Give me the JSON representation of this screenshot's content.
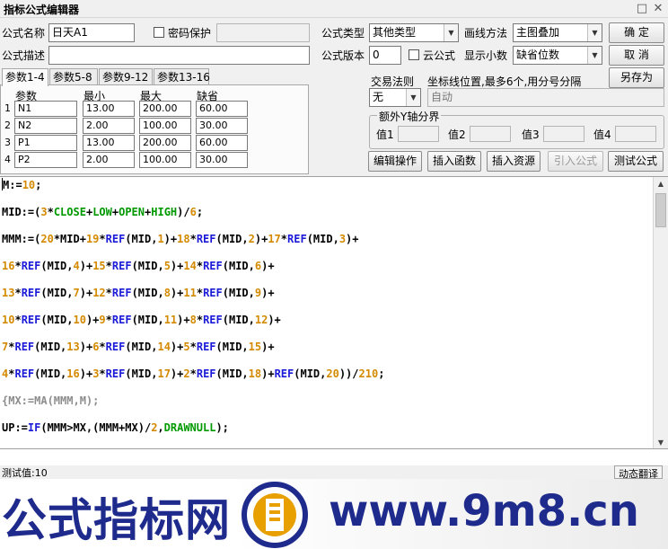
{
  "window": {
    "title": "指标公式编辑器"
  },
  "form": {
    "name_label": "公式名称",
    "name_value": "日天A1",
    "password_label": "密码保护",
    "type_label": "公式类型",
    "type_value": "其他类型",
    "draw_label": "画线方法",
    "draw_value": "主图叠加",
    "desc_label": "公式描述",
    "desc_value": "",
    "version_label": "公式版本",
    "version_value": "0",
    "cloud_label": "云公式",
    "decimal_label": "显示小数",
    "decimal_value": "缺省位数",
    "trade_label": "交易法则",
    "trade_value": "无",
    "coord_label": "坐标线位置,最多6个,用分号分隔",
    "coord_value": "自动",
    "axis_group_label": "额外Y轴分界",
    "axis_values": [
      {
        "label": "值1"
      },
      {
        "label": "值2"
      },
      {
        "label": "值3"
      },
      {
        "label": "值4"
      }
    ]
  },
  "buttons": {
    "ok": "确  定",
    "cancel": "取  消",
    "save_as": "另存为",
    "edit": "编辑操作",
    "insert_func": "插入函数",
    "insert_res": "插入资源",
    "import": "引入公式",
    "test": "测试公式"
  },
  "tabs": [
    {
      "label": "参数1-4"
    },
    {
      "label": "参数5-8"
    },
    {
      "label": "参数9-12"
    },
    {
      "label": "参数13-16"
    }
  ],
  "params": {
    "headers": [
      "参数",
      "最小",
      "最大",
      "缺省"
    ],
    "rows": [
      {
        "n": "1",
        "name": "N1",
        "min": "13.00",
        "max": "200.00",
        "def": "60.00"
      },
      {
        "n": "2",
        "name": "N2",
        "min": "2.00",
        "max": "100.00",
        "def": "30.00"
      },
      {
        "n": "3",
        "name": "P1",
        "min": "13.00",
        "max": "200.00",
        "def": "60.00"
      },
      {
        "n": "4",
        "name": "P2",
        "min": "2.00",
        "max": "100.00",
        "def": "30.00"
      }
    ]
  },
  "code_lines": [
    [
      [
        "id",
        "M:="
      ],
      [
        "num",
        "10"
      ],
      [
        "id",
        ";"
      ]
    ],
    [
      [
        "id",
        "MID:=("
      ],
      [
        "num",
        "3"
      ],
      [
        "id",
        "*"
      ],
      [
        "kw",
        "CLOSE"
      ],
      [
        "id",
        "+"
      ],
      [
        "kw",
        "LOW"
      ],
      [
        "id",
        "+"
      ],
      [
        "kw",
        "OPEN"
      ],
      [
        "id",
        "+"
      ],
      [
        "kw",
        "HIGH"
      ],
      [
        "id",
        ")/"
      ],
      [
        "num",
        "6"
      ],
      [
        "id",
        ";"
      ]
    ],
    [
      [
        "id",
        "MMM:=("
      ],
      [
        "num",
        "20"
      ],
      [
        "id",
        "*MID+"
      ],
      [
        "num",
        "19"
      ],
      [
        "id",
        "*"
      ],
      [
        "fn",
        "REF"
      ],
      [
        "id",
        "(MID,"
      ],
      [
        "num",
        "1"
      ],
      [
        "id",
        ")+"
      ],
      [
        "num",
        "18"
      ],
      [
        "id",
        "*"
      ],
      [
        "fn",
        "REF"
      ],
      [
        "id",
        "(MID,"
      ],
      [
        "num",
        "2"
      ],
      [
        "id",
        ")+"
      ],
      [
        "num",
        "17"
      ],
      [
        "id",
        "*"
      ],
      [
        "fn",
        "REF"
      ],
      [
        "id",
        "(MID,"
      ],
      [
        "num",
        "3"
      ],
      [
        "id",
        ")+"
      ]
    ],
    [
      [
        "num",
        "16"
      ],
      [
        "id",
        "*"
      ],
      [
        "fn",
        "REF"
      ],
      [
        "id",
        "(MID,"
      ],
      [
        "num",
        "4"
      ],
      [
        "id",
        ")+"
      ],
      [
        "num",
        "15"
      ],
      [
        "id",
        "*"
      ],
      [
        "fn",
        "REF"
      ],
      [
        "id",
        "(MID,"
      ],
      [
        "num",
        "5"
      ],
      [
        "id",
        ")+"
      ],
      [
        "num",
        "14"
      ],
      [
        "id",
        "*"
      ],
      [
        "fn",
        "REF"
      ],
      [
        "id",
        "(MID,"
      ],
      [
        "num",
        "6"
      ],
      [
        "id",
        ")+"
      ]
    ],
    [
      [
        "num",
        "13"
      ],
      [
        "id",
        "*"
      ],
      [
        "fn",
        "REF"
      ],
      [
        "id",
        "(MID,"
      ],
      [
        "num",
        "7"
      ],
      [
        "id",
        ")+"
      ],
      [
        "num",
        "12"
      ],
      [
        "id",
        "*"
      ],
      [
        "fn",
        "REF"
      ],
      [
        "id",
        "(MID,"
      ],
      [
        "num",
        "8"
      ],
      [
        "id",
        ")+"
      ],
      [
        "num",
        "11"
      ],
      [
        "id",
        "*"
      ],
      [
        "fn",
        "REF"
      ],
      [
        "id",
        "(MID,"
      ],
      [
        "num",
        "9"
      ],
      [
        "id",
        ")+"
      ]
    ],
    [
      [
        "num",
        "10"
      ],
      [
        "id",
        "*"
      ],
      [
        "fn",
        "REF"
      ],
      [
        "id",
        "(MID,"
      ],
      [
        "num",
        "10"
      ],
      [
        "id",
        ")+"
      ],
      [
        "num",
        "9"
      ],
      [
        "id",
        "*"
      ],
      [
        "fn",
        "REF"
      ],
      [
        "id",
        "(MID,"
      ],
      [
        "num",
        "11"
      ],
      [
        "id",
        ")+"
      ],
      [
        "num",
        "8"
      ],
      [
        "id",
        "*"
      ],
      [
        "fn",
        "REF"
      ],
      [
        "id",
        "(MID,"
      ],
      [
        "num",
        "12"
      ],
      [
        "id",
        ")+"
      ]
    ],
    [
      [
        "num",
        "7"
      ],
      [
        "id",
        "*"
      ],
      [
        "fn",
        "REF"
      ],
      [
        "id",
        "(MID,"
      ],
      [
        "num",
        "13"
      ],
      [
        "id",
        ")+"
      ],
      [
        "num",
        "6"
      ],
      [
        "id",
        "*"
      ],
      [
        "fn",
        "REF"
      ],
      [
        "id",
        "(MID,"
      ],
      [
        "num",
        "14"
      ],
      [
        "id",
        ")+"
      ],
      [
        "num",
        "5"
      ],
      [
        "id",
        "*"
      ],
      [
        "fn",
        "REF"
      ],
      [
        "id",
        "(MID,"
      ],
      [
        "num",
        "15"
      ],
      [
        "id",
        ")+"
      ]
    ],
    [
      [
        "num",
        "4"
      ],
      [
        "id",
        "*"
      ],
      [
        "fn",
        "REF"
      ],
      [
        "id",
        "(MID,"
      ],
      [
        "num",
        "16"
      ],
      [
        "id",
        ")+"
      ],
      [
        "num",
        "3"
      ],
      [
        "id",
        "*"
      ],
      [
        "fn",
        "REF"
      ],
      [
        "id",
        "(MID,"
      ],
      [
        "num",
        "17"
      ],
      [
        "id",
        ")+"
      ],
      [
        "num",
        "2"
      ],
      [
        "id",
        "*"
      ],
      [
        "fn",
        "REF"
      ],
      [
        "id",
        "(MID,"
      ],
      [
        "num",
        "18"
      ],
      [
        "id",
        ")+"
      ],
      [
        "fn",
        "REF"
      ],
      [
        "id",
        "(MID,"
      ],
      [
        "num",
        "20"
      ],
      [
        "id",
        "))/"
      ],
      [
        "num",
        "210"
      ],
      [
        "id",
        ";"
      ]
    ],
    [
      [
        "cm",
        "{MX:=MA(MMM,M);"
      ]
    ],
    [
      [
        "id",
        "UP:="
      ],
      [
        "fn",
        "IF"
      ],
      [
        "id",
        "(MMM>MX,(MMM+MX)/"
      ],
      [
        "num",
        "2"
      ],
      [
        "id",
        ","
      ],
      [
        "kw",
        "DRAWNULL"
      ],
      [
        "id",
        ");"
      ]
    ]
  ],
  "status": {
    "text": "测试值:10",
    "dynamic_translate": "动态翻译"
  },
  "watermark": {
    "left_text": "公式指标网",
    "right_text": "www.9m8.cn"
  },
  "colors": {
    "number": "#d48a00",
    "function": "#1a1ad8",
    "keyword": "#009a00",
    "comment": "#8c8c8c",
    "watermark": "#1e2a8c"
  }
}
